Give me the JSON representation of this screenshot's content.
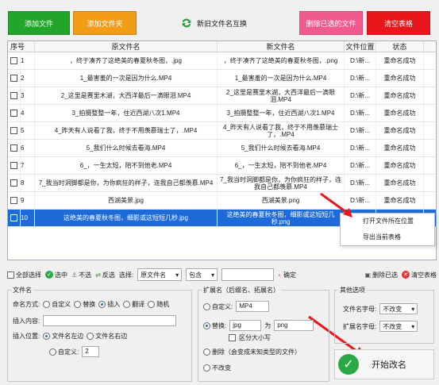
{
  "toolbar": {
    "add_file": "添加文件",
    "add_folder": "添加文件夹",
    "swap_names": "新旧文件名互换",
    "delete_selected": "删除已选的文件",
    "clear_table": "清空表格"
  },
  "table": {
    "headers": {
      "index": "序号",
      "old_name": "原文件名",
      "new_name": "新文件名",
      "location": "文件位置",
      "status": "状态"
    },
    "rows": [
      {
        "n": "1",
        "old": "，终于凑齐了这绝美的春夏秋冬图，.jpg",
        "new": "，终于凑齐了这绝美的春夏秋冬图，.png",
        "loc": "D:\\新...",
        "status": "重命名成功"
      },
      {
        "n": "2",
        "old": "1_最害羞的一次是因为什么.MP4",
        "new": "1_最害羞的一次是因为什么.MP4",
        "loc": "D:\\新...",
        "status": "重命名成功"
      },
      {
        "n": "3",
        "old": "2_这里是赛里木湖，大西洋最后一滴眼泪.MP4",
        "new": "2_这里是赛里木湖，大西洋最后一滴眼泪.MP4",
        "loc": "D:\\新...",
        "status": "重命名成功"
      },
      {
        "n": "4",
        "old": "3_拍摄整整一年，住近西湖八次1.MP4",
        "new": "3_拍摄整整一年，住近西湖八次1.MP4",
        "loc": "D:\\新...",
        "status": "重命名成功"
      },
      {
        "n": "5",
        "old": "4_昨天有人说看了我，终于不用羡慕瑞士了，.MP4",
        "new": "4_昨天有人说看了我，终于不用羡慕瑞士了，.MP4",
        "loc": "D:\\新...",
        "status": "重命名成功"
      },
      {
        "n": "6",
        "old": "5_我们什么时候去看海.MP4",
        "new": "5_我们什么时候去看海.MP4",
        "loc": "D:\\新...",
        "status": "重命名成功"
      },
      {
        "n": "7",
        "old": "6_，一生太短，陪不到他老.MP4",
        "new": "6_，一生太短，陪不到他老.MP4",
        "loc": "D:\\新...",
        "status": "重命名成功"
      },
      {
        "n": "8",
        "old": "7_我当时洞脚都是你，为你疯狂的样子，连我自己都羡慕.MP4",
        "new": "7_我当时洞脚都是你，为你疯狂的样子，连我自己都羡慕.MP4",
        "loc": "D:\\新...",
        "status": "重命名成功"
      },
      {
        "n": "9",
        "old": "西湖美景.jpg",
        "new": "西湖美景.png",
        "loc": "D:\\新...",
        "status": "重命名成功"
      },
      {
        "n": "10",
        "old": "这绝美的春夏秋冬图，细影或这短短几秒.jpg",
        "new": "这绝美的春夏秋冬图，细影或这短短几秒.png",
        "loc": "D:\\新...",
        "status": "重命名成功"
      }
    ]
  },
  "context_menu": {
    "open_location": "打开文件所在位置",
    "export_table": "导出当前表格"
  },
  "filter": {
    "select_all": "全部选择",
    "select": "选中",
    "deselect": "不选",
    "invert": "反选",
    "choose": "选择:",
    "field": "原文件名",
    "op": "包含",
    "confirm": "确定",
    "delete_selected": "删除已选",
    "clear_table": "清空表格"
  },
  "filename": {
    "title": "文件名",
    "mode_label": "命名方式:",
    "modes": [
      "自定义",
      "替换",
      "插入",
      "翻译",
      "随机"
    ],
    "insert_label": "插入内容:",
    "position_label": "插入位置:",
    "pos_left": "文件名左边",
    "pos_right": "文件名右边",
    "custom": "自定义:",
    "custom_value": "2"
  },
  "extension": {
    "title": "扩展名（后缀名、拓展名）",
    "custom": "自定义:",
    "custom_value": "MP4",
    "replace": "替换:",
    "replace_from": "jpg",
    "to": "为",
    "replace_to": "png",
    "case": "区分大小写",
    "delete": "删除（会变成未知类型的文件）",
    "keep": "不改变"
  },
  "other": {
    "title": "其他选项",
    "name_case_label": "文件名字母:",
    "name_case_value": "不改变",
    "ext_case_label": "扩展名字母:",
    "ext_case_value": "不改变"
  },
  "start_button": "开始改名",
  "colors": {
    "green": "#22a52b",
    "orange": "#f39c16",
    "pink": "#f25a8d",
    "red": "#e8171b",
    "select_blue": "#1c6bd8"
  }
}
